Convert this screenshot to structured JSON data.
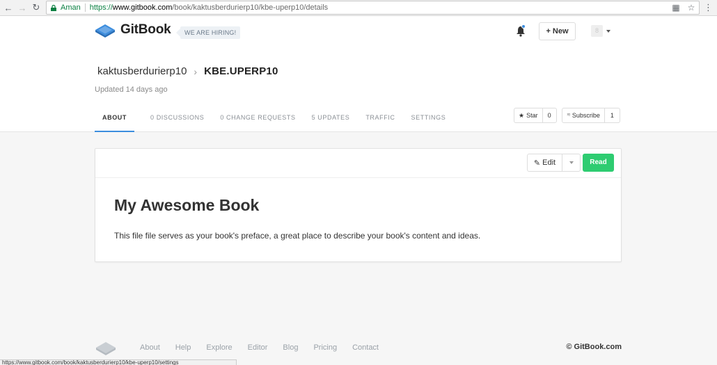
{
  "browser": {
    "secure_label": "Aman",
    "url_scheme": "https://",
    "url_host": "www.gitbook.com",
    "url_path": "/book/kaktusberdurierp10/kbe-uperp10/details",
    "status_url": "https://www.gitbook.com/book/kaktusberdurierp10/kbe-uperp10/settings"
  },
  "header": {
    "logo_text": "GitBook",
    "hiring_badge": "WE ARE HIRING!",
    "new_button": "+ New",
    "avatar_initial": "8"
  },
  "book": {
    "owner": "kaktusberdurierp10",
    "separator": "›",
    "name": "KBE.UPERP10",
    "updated": "Updated 14 days ago"
  },
  "tabs": [
    {
      "label": "ABOUT",
      "active": true
    },
    {
      "label": "0 DISCUSSIONS"
    },
    {
      "label": "0 CHANGE REQUESTS"
    },
    {
      "label": "5 UPDATES"
    },
    {
      "label": "TRAFFIC"
    },
    {
      "label": "SETTINGS"
    }
  ],
  "actions": {
    "star_label": "Star",
    "star_count": "0",
    "subscribe_label": "Subscribe",
    "subscribe_count": "1"
  },
  "card": {
    "edit_label": "Edit",
    "read_label": "Read",
    "title": "My Awesome Book",
    "description": "This file file serves as your book's preface, a great place to describe your book's content and ideas."
  },
  "footer": {
    "links": [
      "About",
      "Help",
      "Explore",
      "Editor",
      "Blog",
      "Pricing",
      "Contact"
    ],
    "copyright": "© GitBook.com"
  },
  "colors": {
    "accent": "#3c8dde",
    "read_button": "#2ecc71",
    "secure_green": "#0b8043"
  }
}
